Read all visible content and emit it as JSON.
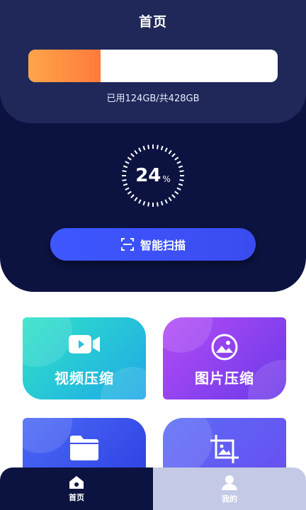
{
  "header": {
    "title": "首页"
  },
  "storage": {
    "used_fraction": 0.29,
    "text": "已用124GB/共428GB"
  },
  "gauge": {
    "value": "24",
    "unit": "%"
  },
  "scan_button": {
    "label": "智能扫描",
    "icon": "scan-frame-icon"
  },
  "tiles": [
    {
      "label": "视频压缩",
      "icon": "video-camera-icon"
    },
    {
      "label": "图片压缩",
      "icon": "image-icon"
    },
    {
      "label": "",
      "icon": "folder-icon"
    },
    {
      "label": "",
      "icon": "crop-image-icon"
    }
  ],
  "bottom_nav": [
    {
      "label": "首页",
      "icon": "home-icon",
      "active": true
    },
    {
      "label": "我的",
      "icon": "user-icon",
      "active": false
    }
  ],
  "colors": {
    "panel": "#0c1340",
    "accent": "#3e57ff",
    "storage_fill": "#ff8a3d"
  }
}
